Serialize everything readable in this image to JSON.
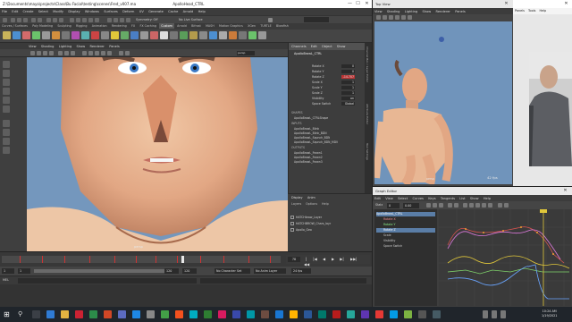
{
  "maya": {
    "title": "Z:\\Documents\\maya\\projects\\Class\\Bu Facial\\testing\\scenes\\Fred_v007.ma",
    "title_right": "ApolloHead_CTRL",
    "menus": [
      "File",
      "Edit",
      "Create",
      "Select",
      "Modify",
      "Display",
      "Windows",
      "Surfaces",
      "Deform",
      "UV",
      "Generate",
      "Cache",
      "Arnold",
      "Help"
    ],
    "status_fields": [
      "Symmetry: Off",
      "No Live Surface"
    ],
    "shelf_tabs": [
      "Curves / Surfaces",
      "Poly Modeling",
      "Sculpting",
      "Rigging",
      "Animation",
      "Rendering",
      "FX",
      "FX Caching",
      "Custom",
      "Arnold",
      "Bifrost",
      "MASH",
      "Motion Graphics",
      "XGen",
      "TURTLE",
      "Blowfish"
    ],
    "active_shelf_tab": "Custom",
    "panel_menus": [
      "View",
      "Shading",
      "Lighting",
      "Show",
      "Renderer",
      "Panels"
    ],
    "viewport_label": "persp",
    "camera_label": "persp"
  },
  "channel_box": {
    "tabs": [
      "Channels",
      "Edit",
      "Object",
      "Show"
    ],
    "object_name": "ApolloBrowL_CTRL",
    "attributes": [
      {
        "name": "Rotate X",
        "value": "0"
      },
      {
        "name": "Rotate Y",
        "value": "0"
      },
      {
        "name": "Rotate Z",
        "value": "-14.707"
      },
      {
        "name": "Scale X",
        "value": "1"
      },
      {
        "name": "Scale Y",
        "value": "1"
      },
      {
        "name": "Scale Z",
        "value": "1"
      },
      {
        "name": "Visibility",
        "value": "on"
      },
      {
        "name": "Space Switch",
        "value": "Global"
      }
    ],
    "shapes_label": "SHAPES",
    "shape_item": "ApolloBrowL_CTRLShape",
    "inputs_label": "INPUTS",
    "inputs": [
      "ApolloBrowL_Blink",
      "ApolloBrowL_Blink_BDN",
      "ApolloBrowL_Squnch_BDN",
      "ApolloBrowL_Squnch_BDN_MDV"
    ],
    "outputs_label": "OUTPUTS",
    "outputs": [
      "ApolloBrowL_Frown1",
      "ApolloBrowL_Frown2",
      "ApolloBrowL_Frown3"
    ],
    "side_tabs": [
      "Channel Box / Layer Editor",
      "Attribute Editor",
      "Tool Settings"
    ]
  },
  "layers": {
    "tabs": [
      "Display",
      "Anim"
    ],
    "menus": [
      "Layers",
      "Options",
      "Help"
    ],
    "rows": [
      "HATCHbrow_Layer",
      "HATCHBROW_Chars_layr",
      "Apollo_Geo"
    ]
  },
  "timeline": {
    "ticks": [
      "1",
      "5",
      "10",
      "15",
      "20",
      "25",
      "30",
      "35",
      "40",
      "45",
      "50",
      "55",
      "60",
      "65",
      "70",
      "75",
      "80",
      "85",
      "90",
      "95",
      "100",
      "105",
      "110",
      "115",
      "120"
    ],
    "current_frame": "78",
    "range_start": "1",
    "range_inner_start": "1",
    "range_inner_end": "120",
    "range_end": "120",
    "fps": "24 fps",
    "no_character_set": "No Character Set",
    "no_anim_layer": "No Anim Layer"
  },
  "topview": {
    "title": "Top View",
    "menus": [
      "View",
      "Shading",
      "Lighting",
      "Show",
      "Renderer",
      "Panels"
    ],
    "fps": "42 fps",
    "camera": "persp"
  },
  "webcam": {
    "menu": [
      "Panels",
      "Tools",
      "Help"
    ]
  },
  "graph_editor": {
    "title": "Graph Editor",
    "menus": [
      "Edit",
      "View",
      "Select",
      "Curves",
      "Keys",
      "Tangents",
      "List",
      "Show",
      "Help"
    ],
    "fields": [
      "Stats",
      "0",
      "0.00"
    ],
    "outliner": [
      {
        "label": "ApolloBrowL_CTRL",
        "selected": true
      },
      {
        "label": "Rotate X",
        "selected": false
      },
      {
        "label": "Rotate Y",
        "selected": false
      },
      {
        "label": "Rotate Z",
        "selected": true
      },
      {
        "label": "Scale",
        "selected": false
      },
      {
        "label": "Visibility",
        "selected": false
      },
      {
        "label": "Space Switch",
        "selected": false
      }
    ],
    "axis_labels": [
      "10",
      "20",
      "30",
      "40",
      "50",
      "60",
      "70",
      "80"
    ],
    "value_labels": [
      "20",
      "10",
      "0",
      "-10",
      "-20"
    ],
    "current_time_marker": "78",
    "colors": {
      "red": "#d9534f",
      "green": "#7fd36a",
      "blue": "#6aa5ff",
      "yellow": "#e0c73a",
      "pink": "#e07adf"
    }
  },
  "taskbar": {
    "time": "10:24 AM",
    "date": "1/19/2021"
  },
  "icons": {
    "close": "✕",
    "minimize": "—",
    "maximize": "☐",
    "play": "▶",
    "play_back": "◀",
    "step_fwd": "▶|",
    "step_back": "|◀",
    "first": "|◀◀",
    "last": "▶▶|",
    "windows": "⊞",
    "search": "⚲"
  }
}
